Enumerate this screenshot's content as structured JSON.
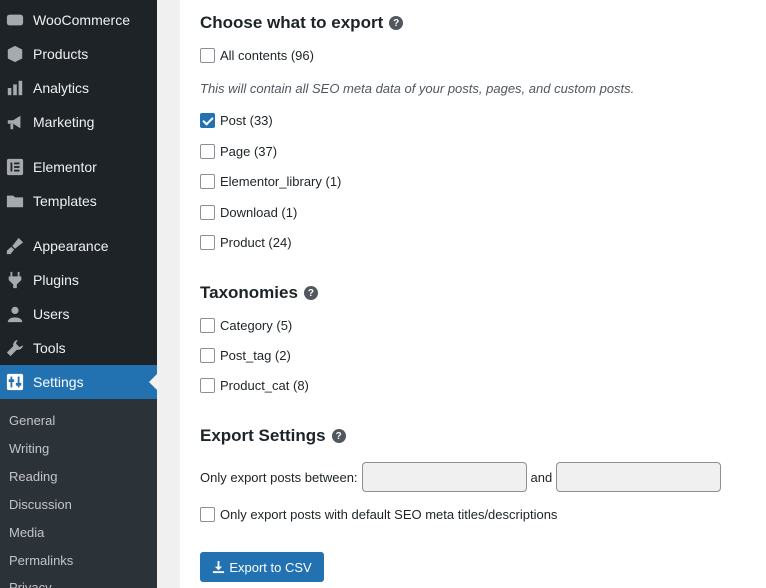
{
  "sidebar": {
    "items": [
      {
        "label": "WooCommerce",
        "icon": "woo-icon"
      },
      {
        "label": "Products",
        "icon": "box-icon"
      },
      {
        "label": "Analytics",
        "icon": "bar-chart-icon"
      },
      {
        "label": "Marketing",
        "icon": "megaphone-icon"
      },
      {
        "label": "Elementor",
        "icon": "elementor-icon"
      },
      {
        "label": "Templates",
        "icon": "folder-icon"
      },
      {
        "label": "Appearance",
        "icon": "paintbrush-icon"
      },
      {
        "label": "Plugins",
        "icon": "plug-icon"
      },
      {
        "label": "Users",
        "icon": "user-icon"
      },
      {
        "label": "Tools",
        "icon": "wrench-icon"
      },
      {
        "label": "Settings",
        "icon": "settings-icon"
      }
    ],
    "submenu": [
      "General",
      "Writing",
      "Reading",
      "Discussion",
      "Media",
      "Permalinks",
      "Privacy"
    ]
  },
  "export": {
    "title": "Choose what to export",
    "all_contents": "All contents (96)",
    "description": "This will contain all SEO meta data of your posts, pages, and custom posts.",
    "post_types": [
      {
        "label": "Post (33)",
        "checked": true
      },
      {
        "label": "Page (37)",
        "checked": false
      },
      {
        "label": "Elementor_library (1)",
        "checked": false
      },
      {
        "label": "Download (1)",
        "checked": false
      },
      {
        "label": "Product (24)",
        "checked": false
      }
    ]
  },
  "taxonomies": {
    "title": "Taxonomies",
    "items": [
      {
        "label": "Category (5)",
        "checked": false
      },
      {
        "label": "Post_tag (2)",
        "checked": false
      },
      {
        "label": "Product_cat (8)",
        "checked": false
      }
    ]
  },
  "settings": {
    "title": "Export Settings",
    "date_label": "Only export posts between:",
    "and_label": "and",
    "default_meta_label": "Only export posts with default SEO meta titles/descriptions",
    "button_label": "Export to CSV"
  },
  "help_glyph": "?"
}
